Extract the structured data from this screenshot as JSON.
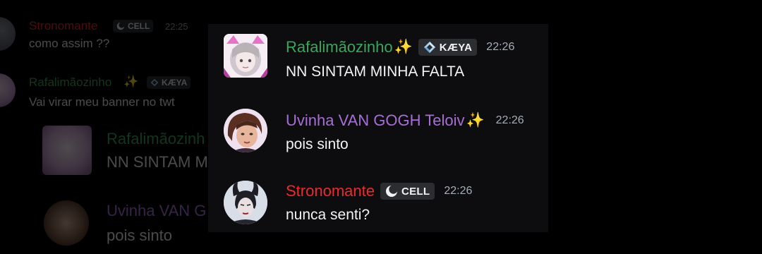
{
  "colors": {
    "name_green": "#3ba55c",
    "name_purple": "#a76fd6",
    "name_red": "#ed2a2a",
    "timestamp": "#a6adb6",
    "panel_bg": "#0d0d10",
    "badge_bg": "#2b2d31"
  },
  "background_chat": {
    "msg1": {
      "author": "Stronomante",
      "badge": "CELL",
      "time": "22:25",
      "text": "como assim ??"
    },
    "msg2": {
      "author": "Rafalimãozinho",
      "sparkle": "✨",
      "badge": "KÆYA",
      "text": "Vai virar meu banner no twt"
    },
    "msg3": {
      "author": "Rafalimãozinh",
      "text": "NN SINTAM M"
    },
    "msg4": {
      "author": "Uvinha VAN G",
      "text": "pois sinto"
    }
  },
  "messages": [
    {
      "author": "Rafalimãozinho",
      "sparkle": "✨",
      "badge": "KÆYA",
      "badge_icon": "diamond-icon",
      "time": "22:26",
      "text": "NN SINTAM MINHA FALTA"
    },
    {
      "author": "Uvinha VAN GOGH Teloiv",
      "sparkle": "✨",
      "time": "22:26",
      "text": "pois sinto"
    },
    {
      "author": "Stronomante",
      "badge": "CELL",
      "badge_icon": "crescent-moon-icon",
      "time": "22:26",
      "text": "nunca senti?"
    }
  ]
}
